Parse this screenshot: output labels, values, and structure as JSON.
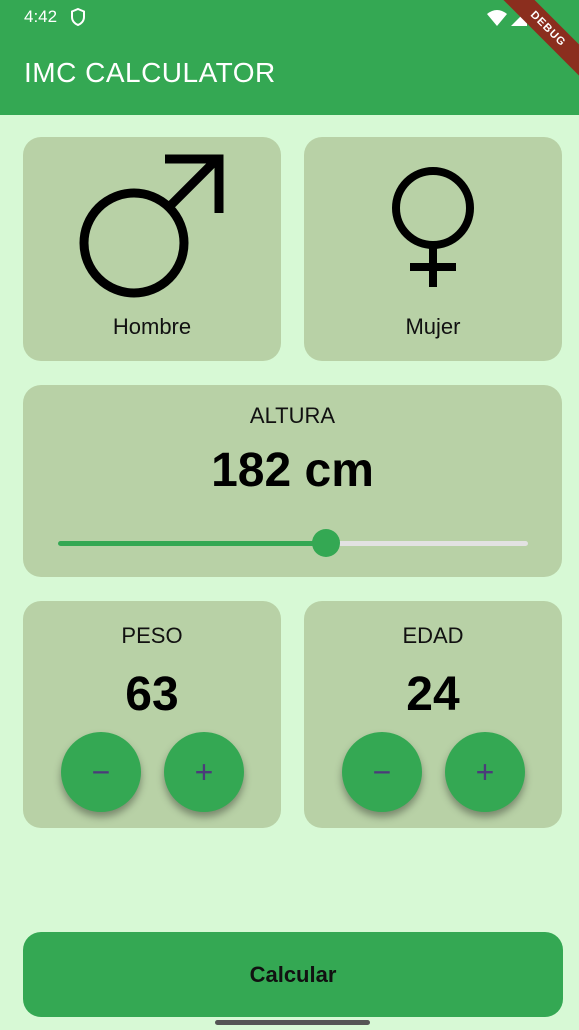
{
  "status": {
    "time": "4:42"
  },
  "debug_banner": "DEBUG",
  "app_title": "IMC CALCULATOR",
  "gender": {
    "male_label": "Hombre",
    "female_label": "Mujer"
  },
  "height": {
    "label": "ALTURA",
    "value": "182 cm",
    "slider_fraction": 0.57
  },
  "weight": {
    "label": "PESO",
    "value": "63",
    "minus": "−",
    "plus": "+"
  },
  "age": {
    "label": "EDAD",
    "value": "24",
    "minus": "−",
    "plus": "+"
  },
  "calculate_button": "Calcular",
  "colors": {
    "primary": "#34a853",
    "card": "#b8d1a6",
    "background": "#d7f9d5"
  }
}
